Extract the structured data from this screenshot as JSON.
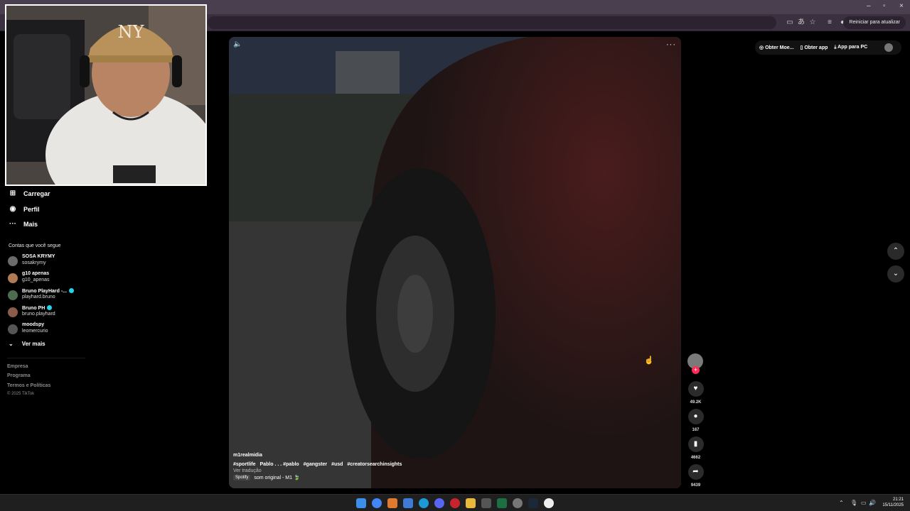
{
  "browser": {
    "window_controls": [
      "–",
      "▫",
      "×"
    ],
    "update_button": "Reiniciar para atualizar"
  },
  "sidebar": {
    "nav": [
      {
        "label": "Carregar",
        "icon": "upload-icon"
      },
      {
        "label": "Perfil",
        "icon": "profile-icon"
      },
      {
        "label": "Mais",
        "icon": "more-dots-icon"
      }
    ],
    "following_title": "Contas que você segue",
    "accounts": [
      {
        "name": "SOSA KRYMY",
        "handle": "sosakrymy",
        "verified": false
      },
      {
        "name": "g10 apenas",
        "handle": "g10_apenas",
        "verified": false
      },
      {
        "name": "Bruno PlayHard -...",
        "handle": "playhard.bruno",
        "verified": true
      },
      {
        "name": "Bruno PH",
        "handle": "bruno.playhard",
        "verified": true
      },
      {
        "name": "moodspy",
        "handle": "leomercurio",
        "verified": false
      }
    ],
    "see_more": "Ver mais",
    "footer_links": [
      "Empresa",
      "Programa",
      "Termos e Políticas"
    ],
    "copyright": "© 2025 TikTok"
  },
  "header": {
    "actions": [
      "Obter Moe...",
      "Obter app",
      "App para PC"
    ]
  },
  "video": {
    "author": "m1realmidia",
    "hashtags": [
      "#sportlife",
      "Pablo . . . #pablo",
      "#gangster",
      "#usd",
      "#creatorsearchinsights"
    ],
    "translate": "Ver tradução",
    "music_badge": "Spotify",
    "music": "som original - M1 🍃"
  },
  "actions": {
    "likes": "49.2K",
    "comments": "167",
    "saves": "4662",
    "shares": "9439"
  },
  "taskbar": {
    "time": "21:21",
    "date": "15/11/2025"
  },
  "colors": {
    "accent_follow": "#fe2c55",
    "verified": "#20d5ec",
    "browser_frame": "#3a303f"
  }
}
